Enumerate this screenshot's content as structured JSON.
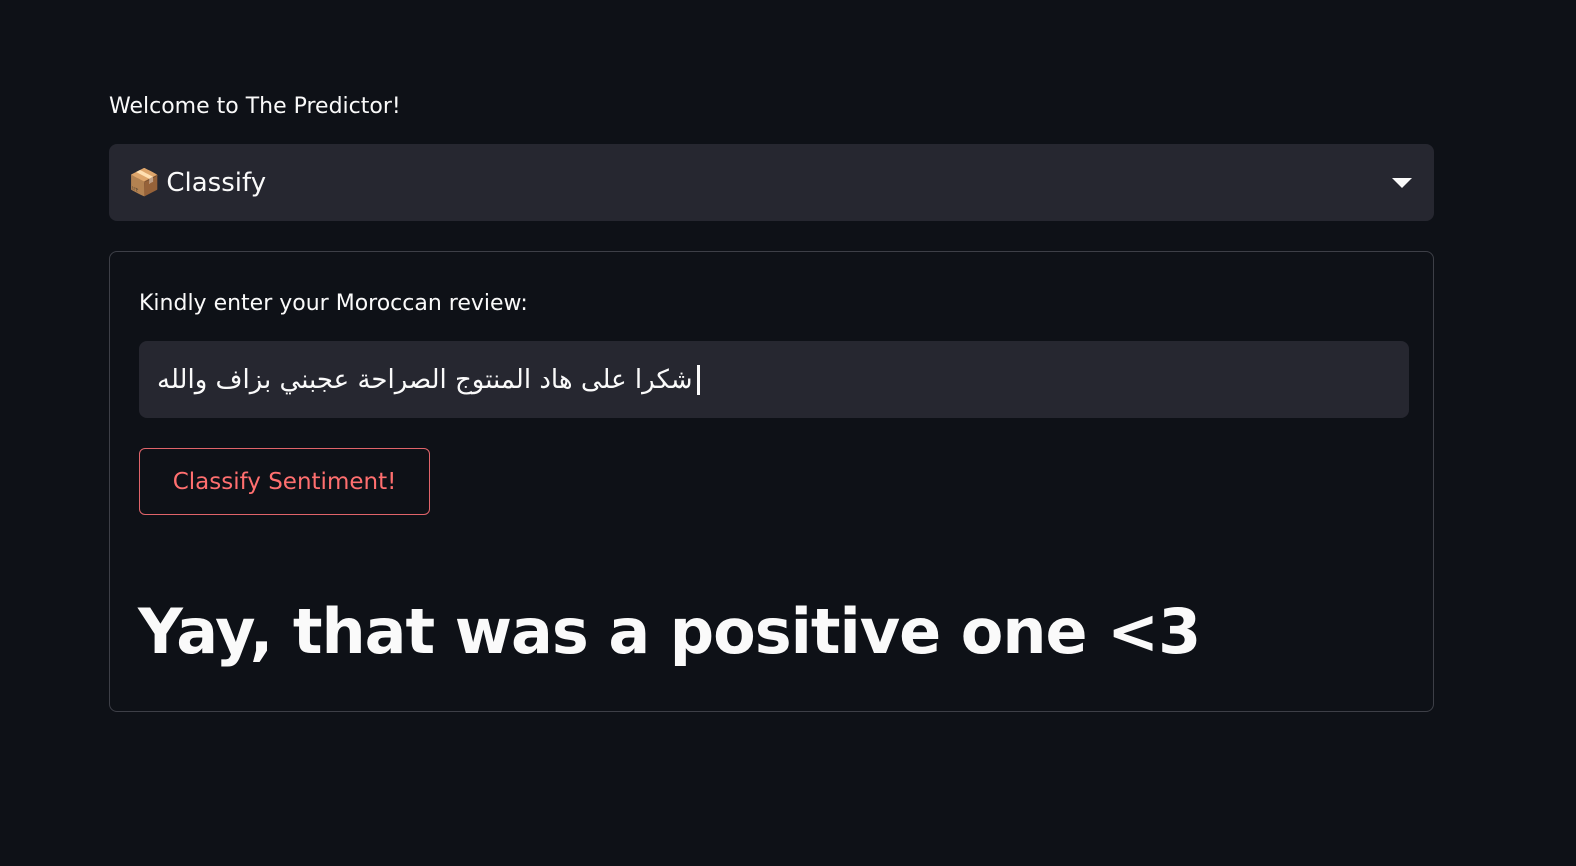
{
  "header": {
    "welcome_text": "Welcome to The Predictor!"
  },
  "mode_select": {
    "icon": "package-icon",
    "icon_glyph": "📦",
    "selected_label": "Classify"
  },
  "form": {
    "input_label": "Kindly enter your Moroccan review:",
    "input_value": "شكرا على هاد المنتوج الصراحة عجبني بزاف والله",
    "button_label": "Classify Sentiment!",
    "result_text": "Yay, that was a positive one <3"
  },
  "colors": {
    "background": "#0e1117",
    "widget": "#262730",
    "accent": "#ff6f6f",
    "border": "#3d3f47"
  }
}
